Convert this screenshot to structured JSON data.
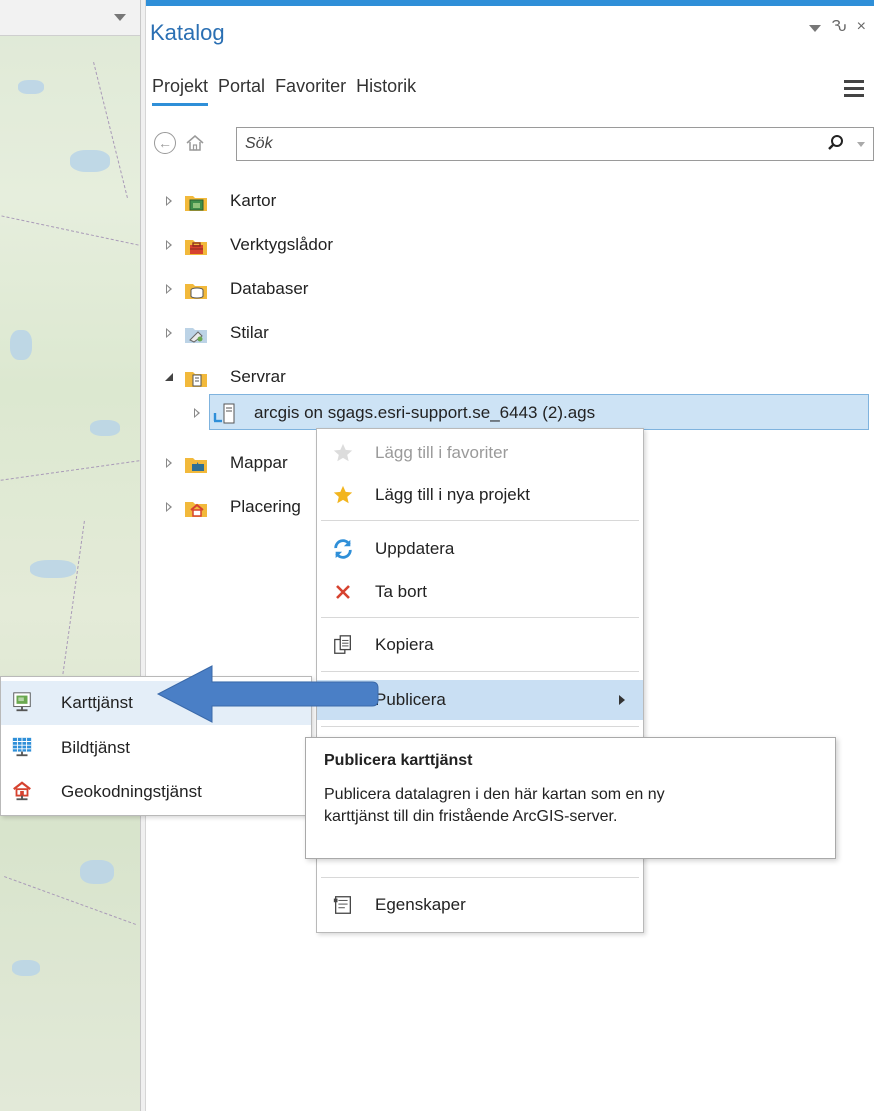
{
  "pane": {
    "title": "Katalog",
    "pin_glyph": "Ԅ",
    "close_glyph": "×",
    "tabs": [
      {
        "label": "Projekt",
        "active": true
      },
      {
        "label": "Portal",
        "active": false
      },
      {
        "label": "Favoriter",
        "active": false
      },
      {
        "label": "Historik",
        "active": false
      }
    ],
    "search": {
      "placeholder": "Sök"
    },
    "icons": {
      "back": "back-icon",
      "home": "home-icon",
      "search": "search-icon",
      "menu": "hamburger-icon"
    }
  },
  "tree": {
    "items": [
      {
        "label": "Kartor",
        "icon": "maps-folder-icon",
        "expanded": false
      },
      {
        "label": "Verktygslådor",
        "icon": "toolbox-folder-icon",
        "expanded": false
      },
      {
        "label": "Databaser",
        "icon": "database-folder-icon",
        "expanded": false
      },
      {
        "label": "Stilar",
        "icon": "styles-folder-icon",
        "expanded": false
      },
      {
        "label": "Servrar",
        "icon": "servers-folder-icon",
        "expanded": true
      },
      {
        "label": "arcgis on sgags.esri-support.se_6443 (2).ags",
        "icon": "server-connection-icon",
        "expanded": false,
        "selected": true
      },
      {
        "label": "Mappar",
        "icon": "folders-folder-icon",
        "expanded": false
      },
      {
        "label": "Placering",
        "icon": "locators-folder-icon",
        "expanded": false
      }
    ]
  },
  "context_menu": {
    "items": [
      {
        "label": "Lägg till i favoriter",
        "icon": "star-icon",
        "disabled": true
      },
      {
        "label": "Lägg till i nya projekt",
        "icon": "star-icon",
        "disabled": false
      },
      {
        "label": "Uppdatera",
        "icon": "refresh-icon",
        "disabled": false
      },
      {
        "label": "Ta bort",
        "icon": "delete-icon",
        "disabled": false
      },
      {
        "label": "Kopiera",
        "icon": "copy-icon",
        "disabled": false
      },
      {
        "label": "Publicera",
        "icon": "",
        "disabled": false,
        "highlighted": true,
        "has_submenu": true
      },
      {
        "label": "Egenskaper",
        "icon": "properties-icon",
        "disabled": false
      }
    ]
  },
  "submenu": {
    "items": [
      {
        "label": "Karttjänst",
        "icon": "map-service-icon",
        "highlighted": true
      },
      {
        "label": "Bildtjänst",
        "icon": "image-service-icon"
      },
      {
        "label": "Geokodningstjänst",
        "icon": "geocode-service-icon"
      }
    ]
  },
  "tooltip": {
    "title": "Publicera karttjänst",
    "body_line1": "Publicera datalagren i den här kartan som en ny",
    "body_line2": "karttjänst till din fristående ArcGIS-server."
  },
  "colors": {
    "accent": "#2f8fd8",
    "selection": "#cde3f5",
    "arrow": "#4a7fc6"
  }
}
